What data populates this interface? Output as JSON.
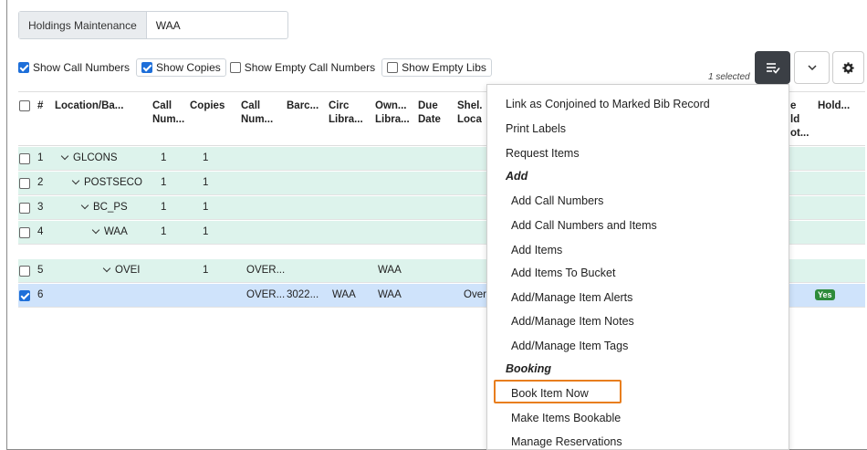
{
  "holdings": {
    "label": "Holdings Maintenance",
    "value": "WAA"
  },
  "options": [
    {
      "label": "Show Call Numbers",
      "checked": true
    },
    {
      "label": "Show Copies",
      "checked": true
    },
    {
      "label": "Show Empty Call Numbers",
      "checked": false
    },
    {
      "label": "Show Empty Libs",
      "checked": false
    }
  ],
  "toolbar": {
    "selected_text": "1 selected",
    "actions_icon": "actions-icon",
    "chevron_icon": "chevron-down-icon",
    "gear_icon": "gear-icon"
  },
  "columns": {
    "num": "#",
    "location": "Location/Ba...",
    "callnum1": "Call\nNum...",
    "copies": "Copies",
    "callnum2": "Call\nNum...",
    "barcode": "Barc...",
    "circlib": "Circ\nLibra...",
    "ownlib": "Own...\nLibra...",
    "duedate": "Due\nDate",
    "shelving": "Shel.\nLoca",
    "partial": "e\nld\not...",
    "holdable": "Hold..."
  },
  "rows": [
    {
      "num": "1",
      "location": "GLCONS",
      "callnums": "1",
      "copies": "1",
      "call": "",
      "barcode": "",
      "circ": "",
      "owning": "",
      "shelving": "",
      "checked": false
    },
    {
      "num": "2",
      "location": "POSTSECO",
      "callnums": "1",
      "copies": "1",
      "call": "",
      "barcode": "",
      "circ": "",
      "owning": "",
      "shelving": "",
      "checked": false
    },
    {
      "num": "3",
      "location": "BC_PS",
      "callnums": "1",
      "copies": "1",
      "call": "",
      "barcode": "",
      "circ": "",
      "owning": "",
      "shelving": "",
      "checked": false
    },
    {
      "num": "4",
      "location": "WAA",
      "callnums": "1",
      "copies": "1",
      "call": "",
      "barcode": "",
      "circ": "",
      "owning": "",
      "shelving": "",
      "checked": false
    },
    {
      "num": "5",
      "location": "OVEI",
      "callnums": "",
      "copies": "1",
      "call": "OVER...",
      "barcode": "",
      "circ": "",
      "owning": "WAA",
      "shelving": "",
      "checked": false
    },
    {
      "num": "6",
      "location": "",
      "callnums": "",
      "copies": "",
      "call": "OVER...",
      "barcode": "3022...",
      "circ": "WAA",
      "owning": "WAA",
      "shelving": "Over",
      "checked": true,
      "holdable": "Yes"
    }
  ],
  "menu": {
    "items_top": [
      "Link as Conjoined to Marked Bib Record",
      "Print Labels",
      "Request Items"
    ],
    "header_add": "Add",
    "items_add": [
      "Add Call Numbers",
      "Add Call Numbers and Items",
      "Add Items",
      "Add Items To Bucket",
      "Add/Manage Item Alerts",
      "Add/Manage Item Notes",
      "Add/Manage Item Tags"
    ],
    "header_booking": "Booking",
    "items_booking": [
      "Book Item Now",
      "Make Items Bookable",
      "Manage Reservations"
    ]
  },
  "colors": {
    "accent_blue": "#1e6fd9",
    "row_green": "#ddf3ec",
    "row_selected": "#cfe3fb",
    "highlight": "#e87e1e",
    "badge_green": "#2e8b3a"
  }
}
